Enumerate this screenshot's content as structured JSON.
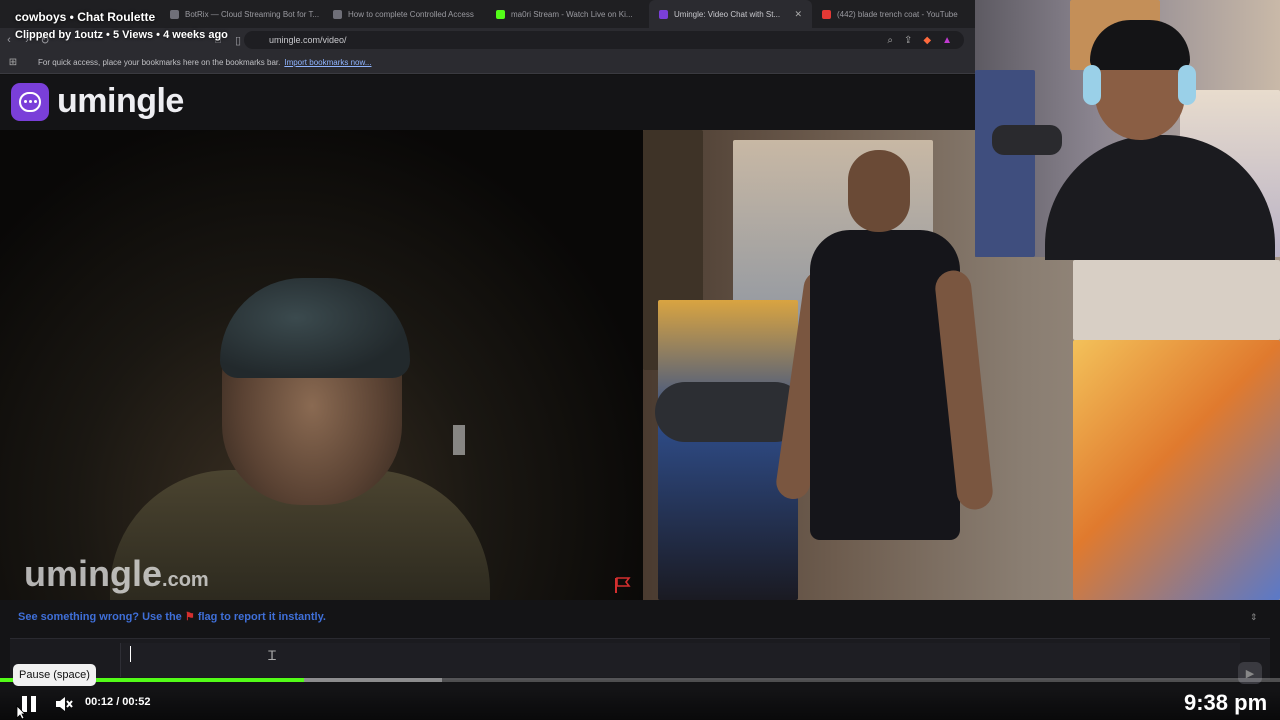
{
  "clip": {
    "title": "cowboys • Chat Roulette",
    "meta": "Clipped by 1outz • 5 Views • 4 weeks ago"
  },
  "browser": {
    "tabs": [
      {
        "label": "BotRix — Cloud Streaming Bot for T...",
        "color": "#6f6f78"
      },
      {
        "label": "How to complete Controlled Access",
        "color": "#6f6f78"
      },
      {
        "label": "ma0ri Stream - Watch Live on Ki...",
        "color": "#53fc18"
      },
      {
        "label": "Umingle: Video Chat with St...",
        "color": "#7a3fd9"
      },
      {
        "label": "(442) blade trench coat - YouTube",
        "color": "#e53935"
      }
    ],
    "url": "umingle.com/video/",
    "bookmarks_hint": "For quick access, place your bookmarks here on the bookmarks bar.",
    "bookmarks_link": "Import bookmarks now..."
  },
  "site": {
    "logo_text": "umingle",
    "watermark": "umingle",
    "watermark_suffix": ".com",
    "report_prefix": "See something wrong? Use the",
    "report_suffix": "flag to report it instantly."
  },
  "player": {
    "tooltip": "Pause (space)",
    "time": "00:12 / 00:52",
    "progress": 0.2375,
    "buffered": 0.345,
    "clock": "9:38 pm"
  },
  "colors": {
    "kick_green": "#53fc18",
    "umingle_purple": "#7a3fd9",
    "report_blue": "#3f6fd8",
    "flag_red": "#d32f2f"
  }
}
